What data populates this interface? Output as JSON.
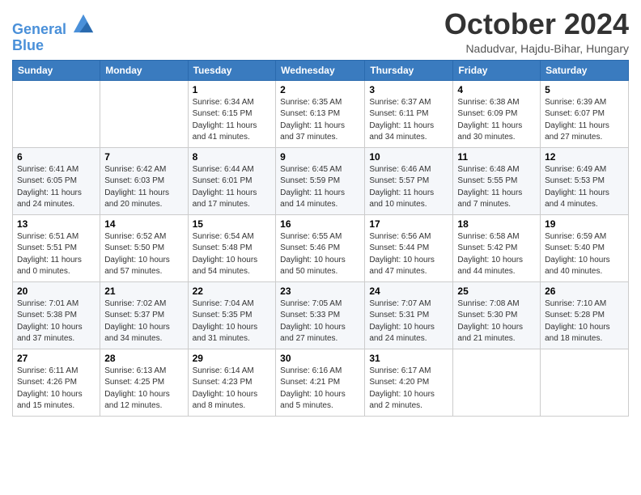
{
  "header": {
    "logo_line1": "General",
    "logo_line2": "Blue",
    "month_title": "October 2024",
    "location": "Nadudvar, Hajdu-Bihar, Hungary"
  },
  "days_of_week": [
    "Sunday",
    "Monday",
    "Tuesday",
    "Wednesday",
    "Thursday",
    "Friday",
    "Saturday"
  ],
  "weeks": [
    [
      {
        "day": "",
        "info": ""
      },
      {
        "day": "",
        "info": ""
      },
      {
        "day": "1",
        "info": "Sunrise: 6:34 AM\nSunset: 6:15 PM\nDaylight: 11 hours and 41 minutes."
      },
      {
        "day": "2",
        "info": "Sunrise: 6:35 AM\nSunset: 6:13 PM\nDaylight: 11 hours and 37 minutes."
      },
      {
        "day": "3",
        "info": "Sunrise: 6:37 AM\nSunset: 6:11 PM\nDaylight: 11 hours and 34 minutes."
      },
      {
        "day": "4",
        "info": "Sunrise: 6:38 AM\nSunset: 6:09 PM\nDaylight: 11 hours and 30 minutes."
      },
      {
        "day": "5",
        "info": "Sunrise: 6:39 AM\nSunset: 6:07 PM\nDaylight: 11 hours and 27 minutes."
      }
    ],
    [
      {
        "day": "6",
        "info": "Sunrise: 6:41 AM\nSunset: 6:05 PM\nDaylight: 11 hours and 24 minutes."
      },
      {
        "day": "7",
        "info": "Sunrise: 6:42 AM\nSunset: 6:03 PM\nDaylight: 11 hours and 20 minutes."
      },
      {
        "day": "8",
        "info": "Sunrise: 6:44 AM\nSunset: 6:01 PM\nDaylight: 11 hours and 17 minutes."
      },
      {
        "day": "9",
        "info": "Sunrise: 6:45 AM\nSunset: 5:59 PM\nDaylight: 11 hours and 14 minutes."
      },
      {
        "day": "10",
        "info": "Sunrise: 6:46 AM\nSunset: 5:57 PM\nDaylight: 11 hours and 10 minutes."
      },
      {
        "day": "11",
        "info": "Sunrise: 6:48 AM\nSunset: 5:55 PM\nDaylight: 11 hours and 7 minutes."
      },
      {
        "day": "12",
        "info": "Sunrise: 6:49 AM\nSunset: 5:53 PM\nDaylight: 11 hours and 4 minutes."
      }
    ],
    [
      {
        "day": "13",
        "info": "Sunrise: 6:51 AM\nSunset: 5:51 PM\nDaylight: 11 hours and 0 minutes."
      },
      {
        "day": "14",
        "info": "Sunrise: 6:52 AM\nSunset: 5:50 PM\nDaylight: 10 hours and 57 minutes."
      },
      {
        "day": "15",
        "info": "Sunrise: 6:54 AM\nSunset: 5:48 PM\nDaylight: 10 hours and 54 minutes."
      },
      {
        "day": "16",
        "info": "Sunrise: 6:55 AM\nSunset: 5:46 PM\nDaylight: 10 hours and 50 minutes."
      },
      {
        "day": "17",
        "info": "Sunrise: 6:56 AM\nSunset: 5:44 PM\nDaylight: 10 hours and 47 minutes."
      },
      {
        "day": "18",
        "info": "Sunrise: 6:58 AM\nSunset: 5:42 PM\nDaylight: 10 hours and 44 minutes."
      },
      {
        "day": "19",
        "info": "Sunrise: 6:59 AM\nSunset: 5:40 PM\nDaylight: 10 hours and 40 minutes."
      }
    ],
    [
      {
        "day": "20",
        "info": "Sunrise: 7:01 AM\nSunset: 5:38 PM\nDaylight: 10 hours and 37 minutes."
      },
      {
        "day": "21",
        "info": "Sunrise: 7:02 AM\nSunset: 5:37 PM\nDaylight: 10 hours and 34 minutes."
      },
      {
        "day": "22",
        "info": "Sunrise: 7:04 AM\nSunset: 5:35 PM\nDaylight: 10 hours and 31 minutes."
      },
      {
        "day": "23",
        "info": "Sunrise: 7:05 AM\nSunset: 5:33 PM\nDaylight: 10 hours and 27 minutes."
      },
      {
        "day": "24",
        "info": "Sunrise: 7:07 AM\nSunset: 5:31 PM\nDaylight: 10 hours and 24 minutes."
      },
      {
        "day": "25",
        "info": "Sunrise: 7:08 AM\nSunset: 5:30 PM\nDaylight: 10 hours and 21 minutes."
      },
      {
        "day": "26",
        "info": "Sunrise: 7:10 AM\nSunset: 5:28 PM\nDaylight: 10 hours and 18 minutes."
      }
    ],
    [
      {
        "day": "27",
        "info": "Sunrise: 6:11 AM\nSunset: 4:26 PM\nDaylight: 10 hours and 15 minutes."
      },
      {
        "day": "28",
        "info": "Sunrise: 6:13 AM\nSunset: 4:25 PM\nDaylight: 10 hours and 12 minutes."
      },
      {
        "day": "29",
        "info": "Sunrise: 6:14 AM\nSunset: 4:23 PM\nDaylight: 10 hours and 8 minutes."
      },
      {
        "day": "30",
        "info": "Sunrise: 6:16 AM\nSunset: 4:21 PM\nDaylight: 10 hours and 5 minutes."
      },
      {
        "day": "31",
        "info": "Sunrise: 6:17 AM\nSunset: 4:20 PM\nDaylight: 10 hours and 2 minutes."
      },
      {
        "day": "",
        "info": ""
      },
      {
        "day": "",
        "info": ""
      }
    ]
  ]
}
